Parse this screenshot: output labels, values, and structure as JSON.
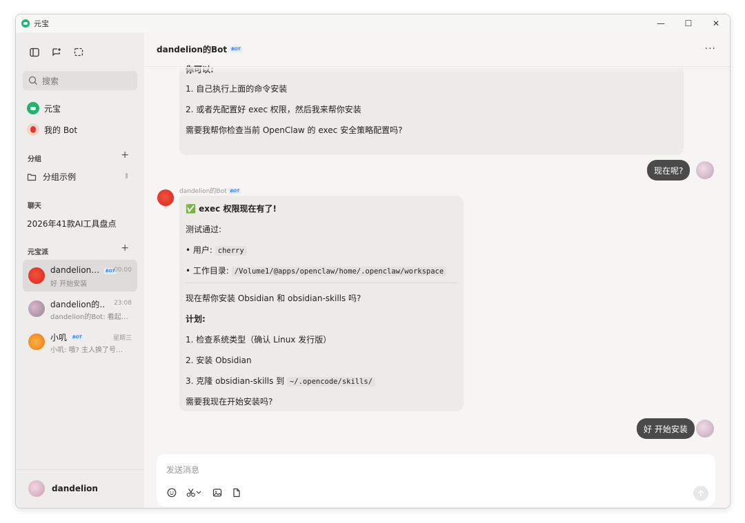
{
  "window": {
    "app_title": "元宝",
    "minimize": "—",
    "maximize": "☐",
    "close": "✕"
  },
  "sidebar": {
    "search_placeholder": "搜索",
    "nav": [
      {
        "label": "元宝"
      },
      {
        "label": "我的 Bot"
      }
    ],
    "groups_label": "分组",
    "group_example": "分组示例",
    "chat_label": "聊天",
    "chat_item": "2026年41款AI工具盘点",
    "yuanbao_label": "元宝派",
    "chats": [
      {
        "name": "dandelion…",
        "badge": "BOT",
        "time": "00:00",
        "preview": "好 开始安装"
      },
      {
        "name": "dandelion的…",
        "badge": "",
        "time": "23:08",
        "preview": "dandelion的Bot: 看起…"
      },
      {
        "name": "小叽",
        "badge": "BOT",
        "time": "星期三",
        "preview": "小叽: 哦? 主人换了号…"
      }
    ],
    "user_name": "dandelion"
  },
  "header": {
    "title": "dandelion的Bot",
    "badge": "BOT",
    "more": "···"
  },
  "messages": {
    "prev": {
      "line0": "你可以:",
      "line1": "1. 自己执行上面的命令安装",
      "line2": "2. 或者先配置好 exec 权限，然后我来帮你安装",
      "line3": "需要我帮你检查当前 OpenClaw 的 exec 安全策略配置吗?"
    },
    "user1": "现在呢?",
    "bot_sender": "dandelion的Bot",
    "bot_badge": "BOT",
    "bot": {
      "title_check": "✅",
      "title": "exec 权限现在有了!",
      "test_pass": "测试通过:",
      "user_label": "• 用户:",
      "user_value": "cherry",
      "dir_label": "• 工作目录:",
      "dir_value": "/Volume1/@apps/openclaw/home/.openclaw/workspace",
      "ask_install": "现在帮你安装 Obsidian 和 obsidian-skills 吗?",
      "plan": "计划:",
      "step1": "1. 检查系统类型（确认 Linux 发行版）",
      "step2": "2. 安装 Obsidian",
      "step3_pre": "3. 克隆 obsidian-skills 到",
      "step3_code": "~/.opencode/skills/",
      "ask_now": "需要我现在开始安装吗?"
    },
    "user2": "好 开始安装"
  },
  "composer": {
    "placeholder": "发送消息"
  }
}
